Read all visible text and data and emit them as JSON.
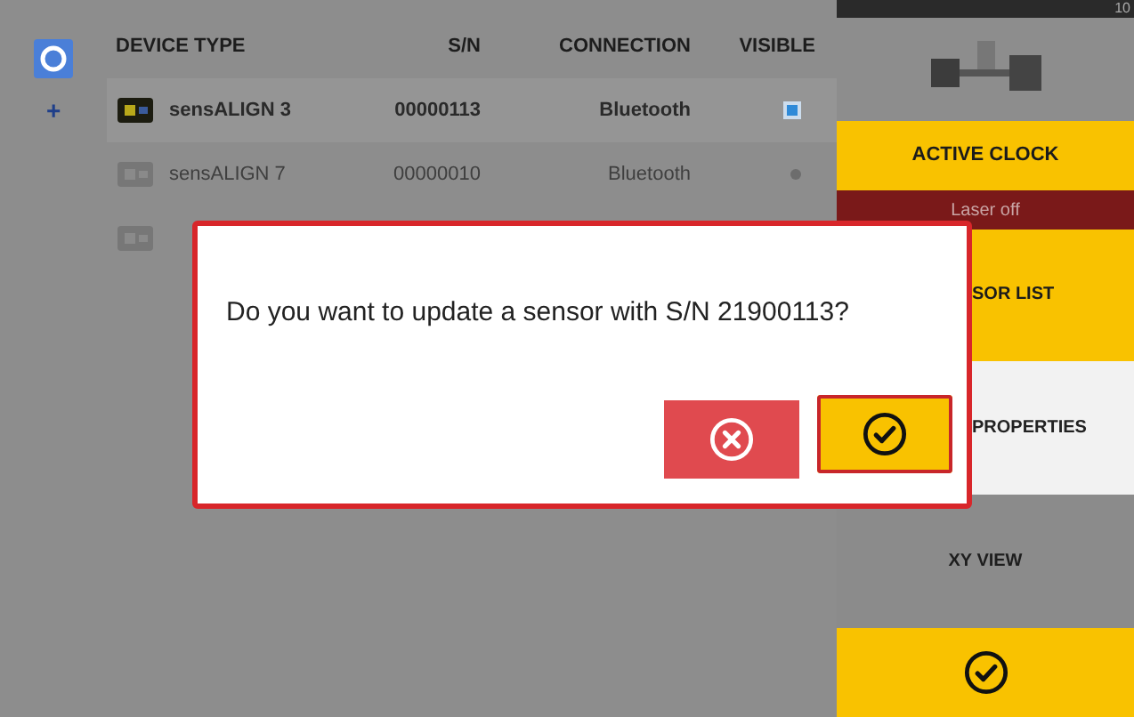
{
  "table": {
    "columns": [
      "DEVICE TYPE",
      "S/N",
      "CONNECTION",
      "VISIBLE"
    ],
    "rows": [
      {
        "expand_symbol": "+",
        "device": "sensALIGN 3",
        "sn": "00000113",
        "connection": "Bluetooth",
        "visible": true,
        "selected": true
      },
      {
        "device": "sensALIGN 7",
        "sn": "00000010",
        "connection": "Bluetooth",
        "visible": false,
        "selected": false
      },
      {
        "selected": false
      }
    ]
  },
  "status_bar": {
    "time": "10"
  },
  "panel": [
    {
      "kind": "accent",
      "label": "ACTIVE CLOCK"
    },
    {
      "kind": "banner",
      "label": "Laser off"
    },
    {
      "kind": "accent",
      "label": "SOR LIST"
    },
    {
      "kind": "light",
      "label": "PROPERTIES"
    },
    {
      "kind": "plain",
      "label": "XY VIEW"
    },
    {
      "kind": "confirm"
    }
  ],
  "dialog": {
    "message": "Do you want to update a sensor with S/N 21900113?",
    "buttons": [
      {
        "kind": "cancel",
        "selected": false
      },
      {
        "kind": "confirm",
        "selected": true
      }
    ]
  }
}
